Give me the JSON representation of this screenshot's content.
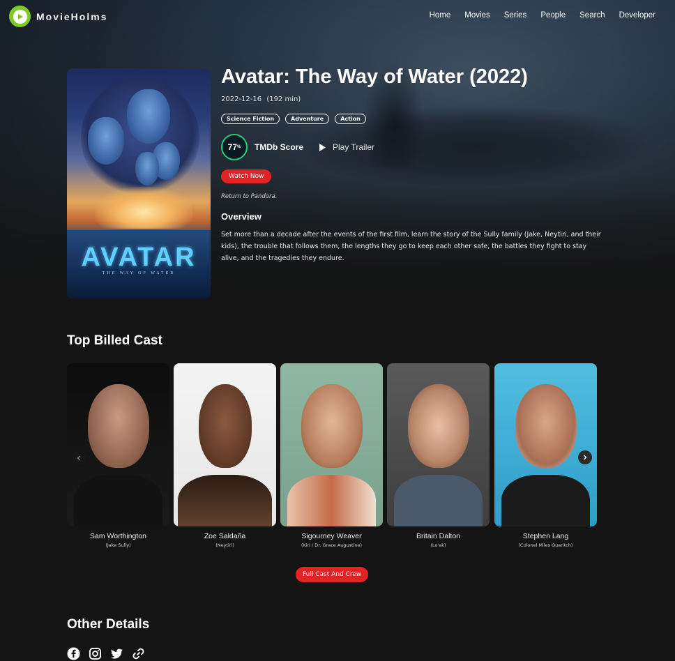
{
  "brand": {
    "name": "MovieHolms",
    "accent": "#7ecb28"
  },
  "nav": {
    "links": [
      "Home",
      "Movies",
      "Series",
      "People",
      "Search",
      "Developer"
    ]
  },
  "movie": {
    "title": "Avatar: The Way of Water (2022)",
    "release_date": "2022-12-16",
    "runtime": "(192 min)",
    "genres": [
      "Science Fiction",
      "Adventure",
      "Action"
    ],
    "score": "77",
    "score_unit": "%",
    "score_label": "TMDb Score",
    "trailer_label": "Play Trailer",
    "watch_label": "Watch Now",
    "tagline": "Return to Pandora.",
    "overview_heading": "Overview",
    "overview": "Set more than a decade after the events of the first film, learn the story of the Sully family (Jake, Neytiri, and their kids), the trouble that follows them, the lengths they go to keep each other safe, the battles they fight to stay alive, and the tragedies they endure.",
    "poster": {
      "title": "AVATAR",
      "subtitle": "THE WAY OF WATER"
    }
  },
  "cast_section": {
    "heading": "Top Billed Cast",
    "members": [
      {
        "name": "Sam Worthington",
        "role": "(Jake Sully)"
      },
      {
        "name": "Zoe Saldaña",
        "role": "(Neytiri)"
      },
      {
        "name": "Sigourney Weaver",
        "role": "(Kiri / Dr. Grace Augustine)"
      },
      {
        "name": "Britain Dalton",
        "role": "(Lo'ak)"
      },
      {
        "name": "Stephen Lang",
        "role": "(Colonel Miles Quaritch)"
      }
    ],
    "full_cast_label": "Full Cast And Crew"
  },
  "other_details": {
    "heading": "Other Details",
    "social_icons": [
      "facebook-icon",
      "instagram-icon",
      "twitter-icon",
      "link-icon"
    ]
  },
  "colors": {
    "primary_button": "#e02424",
    "score_ring": "#21d07a",
    "background": "#141414"
  }
}
